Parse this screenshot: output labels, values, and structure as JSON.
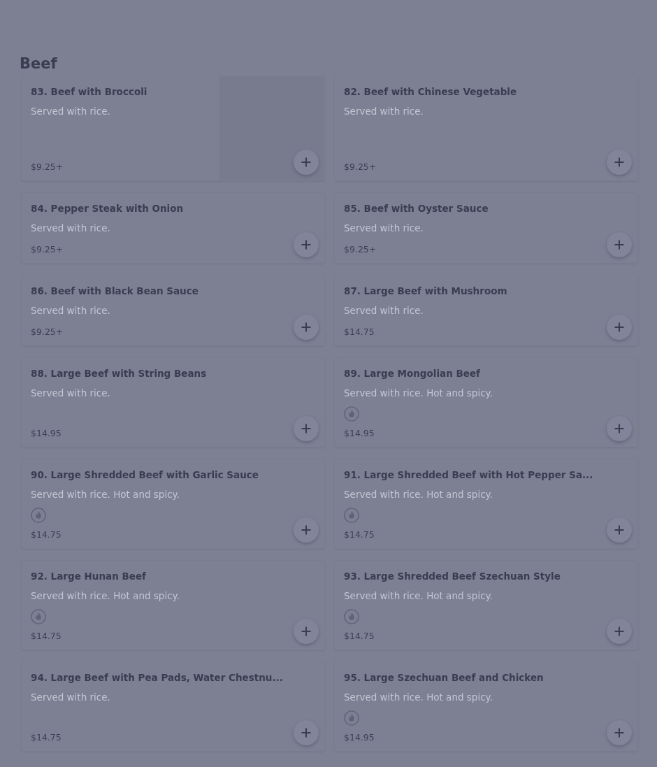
{
  "section": {
    "title": "Beef"
  },
  "items": [
    {
      "name": "83. Beef with Broccoli",
      "description": "Served with rice.",
      "price": "$9.25+",
      "spicy": false,
      "has_image": true
    },
    {
      "name": "82. Beef with Chinese Vegetable",
      "description": "Served with rice.",
      "price": "$9.25+",
      "spicy": false,
      "has_image": false
    },
    {
      "name": "84. Pepper Steak with Onion",
      "description": "Served with rice.",
      "price": "$9.25+",
      "spicy": false,
      "has_image": false
    },
    {
      "name": "85. Beef with Oyster Sauce",
      "description": "Served with rice.",
      "price": "$9.25+",
      "spicy": false,
      "has_image": false
    },
    {
      "name": "86. Beef with Black Bean Sauce",
      "description": "Served with rice.",
      "price": "$9.25+",
      "spicy": false,
      "has_image": false
    },
    {
      "name": "87. Large Beef with Mushroom",
      "description": "Served with rice.",
      "price": "$14.75",
      "spicy": false,
      "has_image": false
    },
    {
      "name": "88. Large Beef with String Beans",
      "description": "Served with rice.",
      "price": "$14.95",
      "spicy": false,
      "has_image": false
    },
    {
      "name": "89. Large Mongolian Beef",
      "description": "Served with rice. Hot and spicy.",
      "price": "$14.95",
      "spicy": true,
      "has_image": false
    },
    {
      "name": "90. Large Shredded Beef with Garlic Sauce",
      "description": "Served with rice. Hot and spicy.",
      "price": "$14.75",
      "spicy": true,
      "has_image": false
    },
    {
      "name": "91. Large Shredded Beef with Hot Pepper Sa...",
      "description": "Served with rice. Hot and spicy.",
      "price": "$14.75",
      "spicy": true,
      "has_image": false
    },
    {
      "name": "92. Large Hunan Beef",
      "description": "Served with rice. Hot and spicy.",
      "price": "$14.75",
      "spicy": true,
      "has_image": false
    },
    {
      "name": "93. Large Shredded Beef Szechuan Style",
      "description": "Served with rice. Hot and spicy.",
      "price": "$14.75",
      "spicy": true,
      "has_image": false
    },
    {
      "name": "94. Large Beef with Pea Pads, Water Chestnu...",
      "description": "Served with rice.",
      "price": "$14.75",
      "spicy": false,
      "has_image": false
    },
    {
      "name": "95. Large Szechuan Beef and Chicken",
      "description": "Served with rice. Hot and spicy.",
      "price": "$14.95",
      "spicy": true,
      "has_image": false
    }
  ]
}
